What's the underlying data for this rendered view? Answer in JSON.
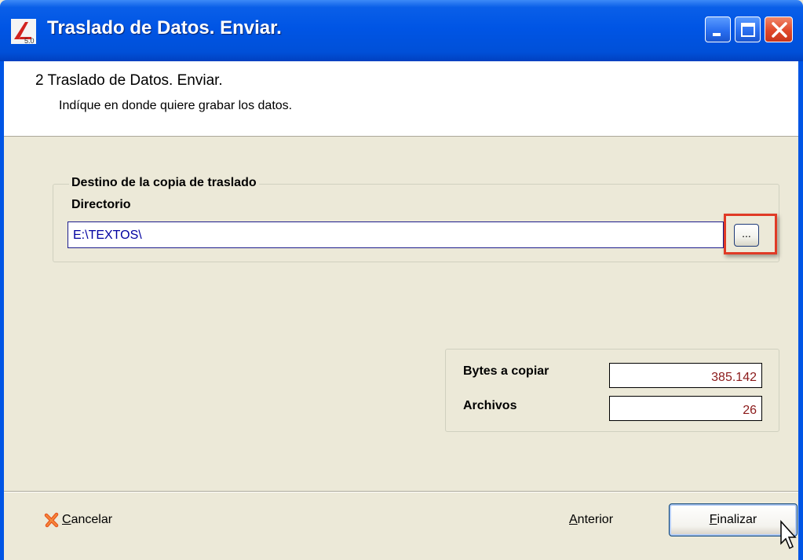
{
  "window": {
    "title": "Traslado de Datos. Enviar.",
    "icon": "app-logo-icon",
    "icon_text": "5.0",
    "controls": [
      "minimize-icon",
      "maximize-icon",
      "close-icon"
    ]
  },
  "header": {
    "step_title": "2 Traslado de Datos. Enviar.",
    "subtitle": "Indíque en donde quiere grabar los datos."
  },
  "destination": {
    "group_title": "Destino de la copia de traslado",
    "dir_label": "Directorio",
    "dir_value": "E:\\TEXTOS\\",
    "browse_label": "...",
    "highlight_color": "#E03A26"
  },
  "stats": {
    "bytes_label": "Bytes a copiar",
    "bytes_value": "385.142",
    "files_label": "Archivos",
    "files_value": "26",
    "value_color": "#8B1A1A"
  },
  "footer": {
    "cancel_label": "Cancelar",
    "cancel_mnemonic": "C",
    "cancel_rest": "ancelar",
    "prev_mnemonic": "A",
    "prev_rest": "nterior",
    "finish_mnemonic": "F",
    "finish_rest": "inalizar"
  },
  "colors": {
    "titlebar": "#0055E5",
    "window_bg": "#ECE9D8"
  }
}
